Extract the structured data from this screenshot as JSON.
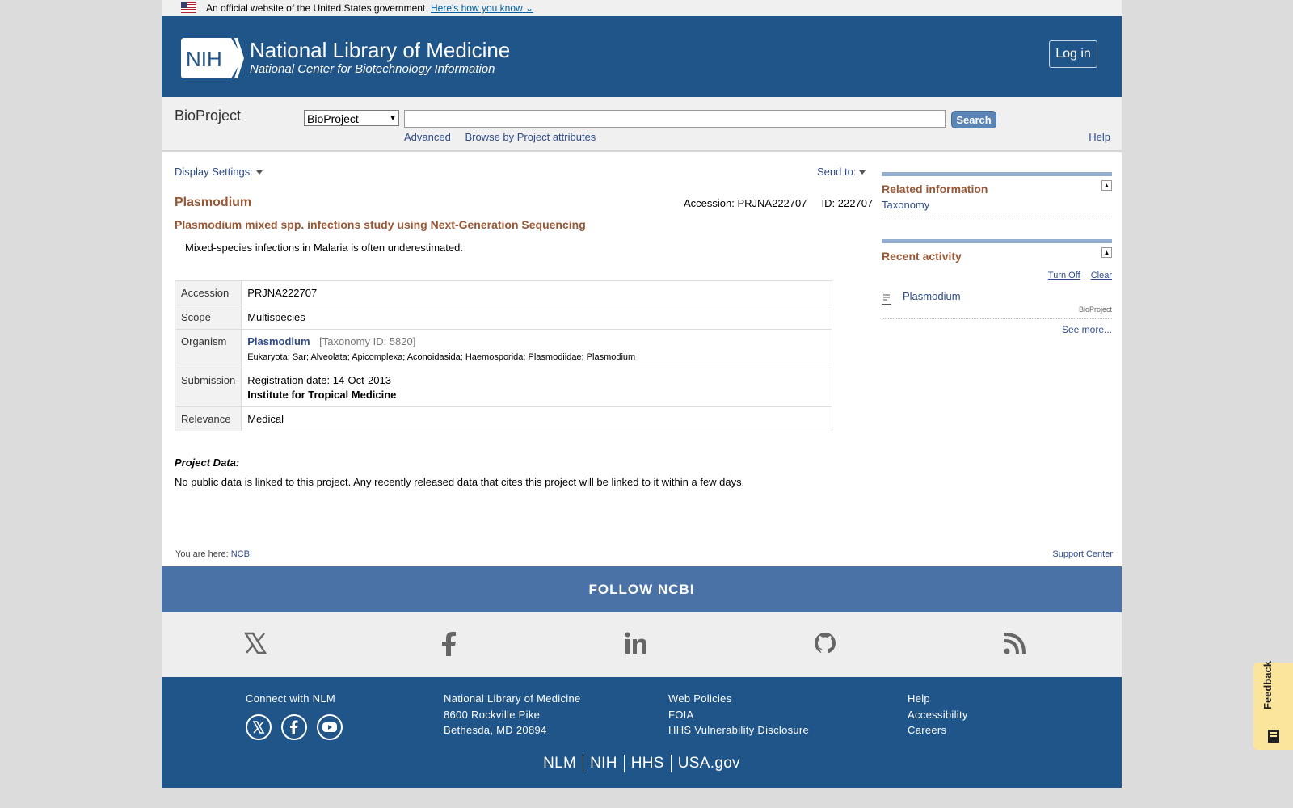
{
  "gov_banner": {
    "text": "An official website of the United States government",
    "how_link": "Here's how you know"
  },
  "masthead": {
    "logo_text": "NIH",
    "title": "National Library of Medicine",
    "subtitle": "National Center for Biotechnology Information",
    "login_label": "Log in"
  },
  "search": {
    "db_name": "BioProject",
    "db_selected": "BioProject",
    "term_value": "",
    "search_label": "Search",
    "advanced_label": "Advanced",
    "browse_label": "Browse by Project attributes",
    "help_label": "Help"
  },
  "record": {
    "display_settings": "Display Settings:",
    "send_to": "Send to:",
    "title": "Plasmodium",
    "accession_line": "Accession: PRJNA222707",
    "id_line": "ID: 222707",
    "subtitle": "Plasmodium mixed spp. infections study using Next-Generation Sequencing",
    "description": "Mixed-species infections in Malaria is often underestimated.",
    "table": {
      "accession_label": "Accession",
      "accession_value": "PRJNA222707",
      "scope_label": "Scope",
      "scope_value": "Multispecies",
      "organism_label": "Organism",
      "organism_name": "Plasmodium",
      "taxonomy_id": "[Taxonomy ID: 5820]",
      "lineage": "Eukaryota; Sar; Alveolata; Apicomplexa; Aconoidasida; Haemosporida; Plasmodiidae; Plasmodium",
      "submission_label": "Submission",
      "registration": "Registration date: 14-Oct-2013",
      "institute": "Institute for Tropical Medicine",
      "relevance_label": "Relevance",
      "relevance_value": "Medical"
    },
    "project_data_heading": "Project Data:",
    "project_data_text": "No public data is linked to this project. Any recently released data that cites this project will be linked to it within a few days."
  },
  "sidebar": {
    "related_title": "Related information",
    "related_link": "Taxonomy",
    "recent_title": "Recent activity",
    "turn_off": "Turn Off",
    "clear": "Clear",
    "recent_item": "Plasmodium",
    "recent_item_db": "BioProject",
    "see_more": "See more..."
  },
  "breadcrumb": {
    "prefix": "You are here:",
    "link": "NCBI",
    "support": "Support Center"
  },
  "footer": {
    "follow": "FOLLOW NCBI",
    "connect": "Connect with NLM",
    "addr1": "National Library of Medicine",
    "addr2": "8600 Rockville Pike",
    "addr3": "Bethesda, MD 20894",
    "web_policies": "Web Policies",
    "foia": "FOIA",
    "hhs_vuln": "HHS Vulnerability Disclosure",
    "help": "Help",
    "accessibility": "Accessibility",
    "careers": "Careers",
    "agencies": [
      "NLM",
      "NIH",
      "HHS",
      "USA.gov"
    ]
  },
  "feedback_label": "Feedback",
  "colors": {
    "masthead": "#20558a",
    "accent_brown": "#985735",
    "link": "#2f4a8a",
    "follow_bar": "#4a72a6"
  }
}
